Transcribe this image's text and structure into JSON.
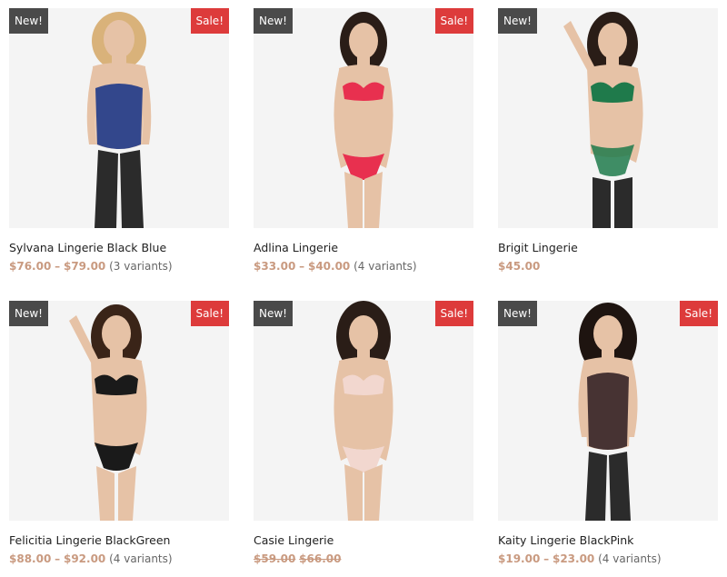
{
  "colors": {
    "new_badge": "#4a4a4a",
    "sale_badge": "#dd3b3b",
    "price": "#c99a80",
    "image_bg": "#f4f4f4"
  },
  "products": [
    {
      "name": "Sylvana Lingerie Black Blue",
      "new_badge": "New!",
      "sale_badge": "Sale!",
      "price_min": "$76.00",
      "separator": "–",
      "price_max": "$79.00",
      "variants": "(3 variants)",
      "accent": "#1f3a8a",
      "hair": "#d9b27a"
    },
    {
      "name": "Adlina Lingerie",
      "new_badge": "New!",
      "sale_badge": "Sale!",
      "price_min": "$33.00",
      "separator": "–",
      "price_max": "$40.00",
      "variants": "(4 variants)",
      "accent": "#e8304f",
      "hair": "#2a1d17"
    },
    {
      "name": "Brigit Lingerie",
      "new_badge": "New!",
      "price_min": "$45.00",
      "accent": "#1f7a4b",
      "hair": "#2a1d17"
    },
    {
      "name": "Felicitia Lingerie BlackGreen",
      "new_badge": "New!",
      "sale_badge": "Sale!",
      "price_min": "$88.00",
      "separator": "–",
      "price_max": "$92.00",
      "variants": "(4 variants)",
      "accent": "#1a1a1a",
      "hair": "#3a2418"
    },
    {
      "name": "Casie Lingerie",
      "new_badge": "New!",
      "sale_badge": "Sale!",
      "price_current": "$59.00",
      "price_old": "$66.00",
      "accent": "#f2d7cf",
      "hair": "#2a1d17"
    },
    {
      "name": "Kaity Lingerie BlackPink",
      "new_badge": "New!",
      "sale_badge": "Sale!",
      "price_min": "$19.00",
      "separator": "–",
      "price_max": "$23.00",
      "variants": "(4 variants)",
      "accent": "#2a1a1f",
      "hair": "#1e1410"
    }
  ]
}
